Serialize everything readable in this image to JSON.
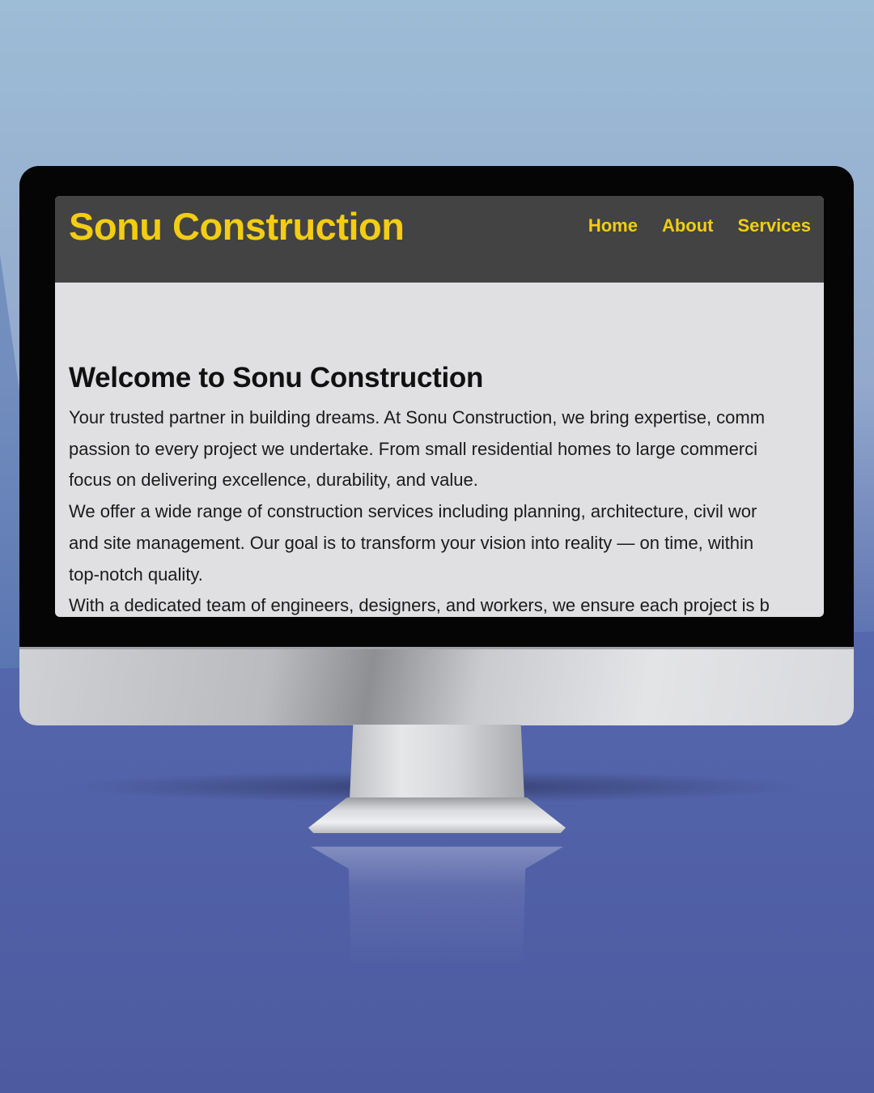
{
  "site": {
    "title": "Sonu Construction",
    "nav": [
      {
        "label": "Home"
      },
      {
        "label": "About"
      },
      {
        "label": "Services"
      }
    ]
  },
  "main": {
    "heading": "Welcome to Sonu Construction",
    "lines": [
      "Your trusted partner in building dreams. At Sonu Construction, we bring expertise, comm",
      "passion to every project we undertake. From small residential homes to large commerci",
      "focus on delivering excellence, durability, and value.",
      "We offer a wide range of construction services including planning, architecture, civil wor",
      "and site management. Our goal is to transform your vision into reality — on time, within",
      "top-notch quality.",
      "With a dedicated team of engineers, designers, and workers, we ensure each project is b"
    ]
  },
  "colors": {
    "header_bg": "#434343",
    "accent_yellow": "#f2cd14",
    "content_bg": "#e0e0e2"
  }
}
